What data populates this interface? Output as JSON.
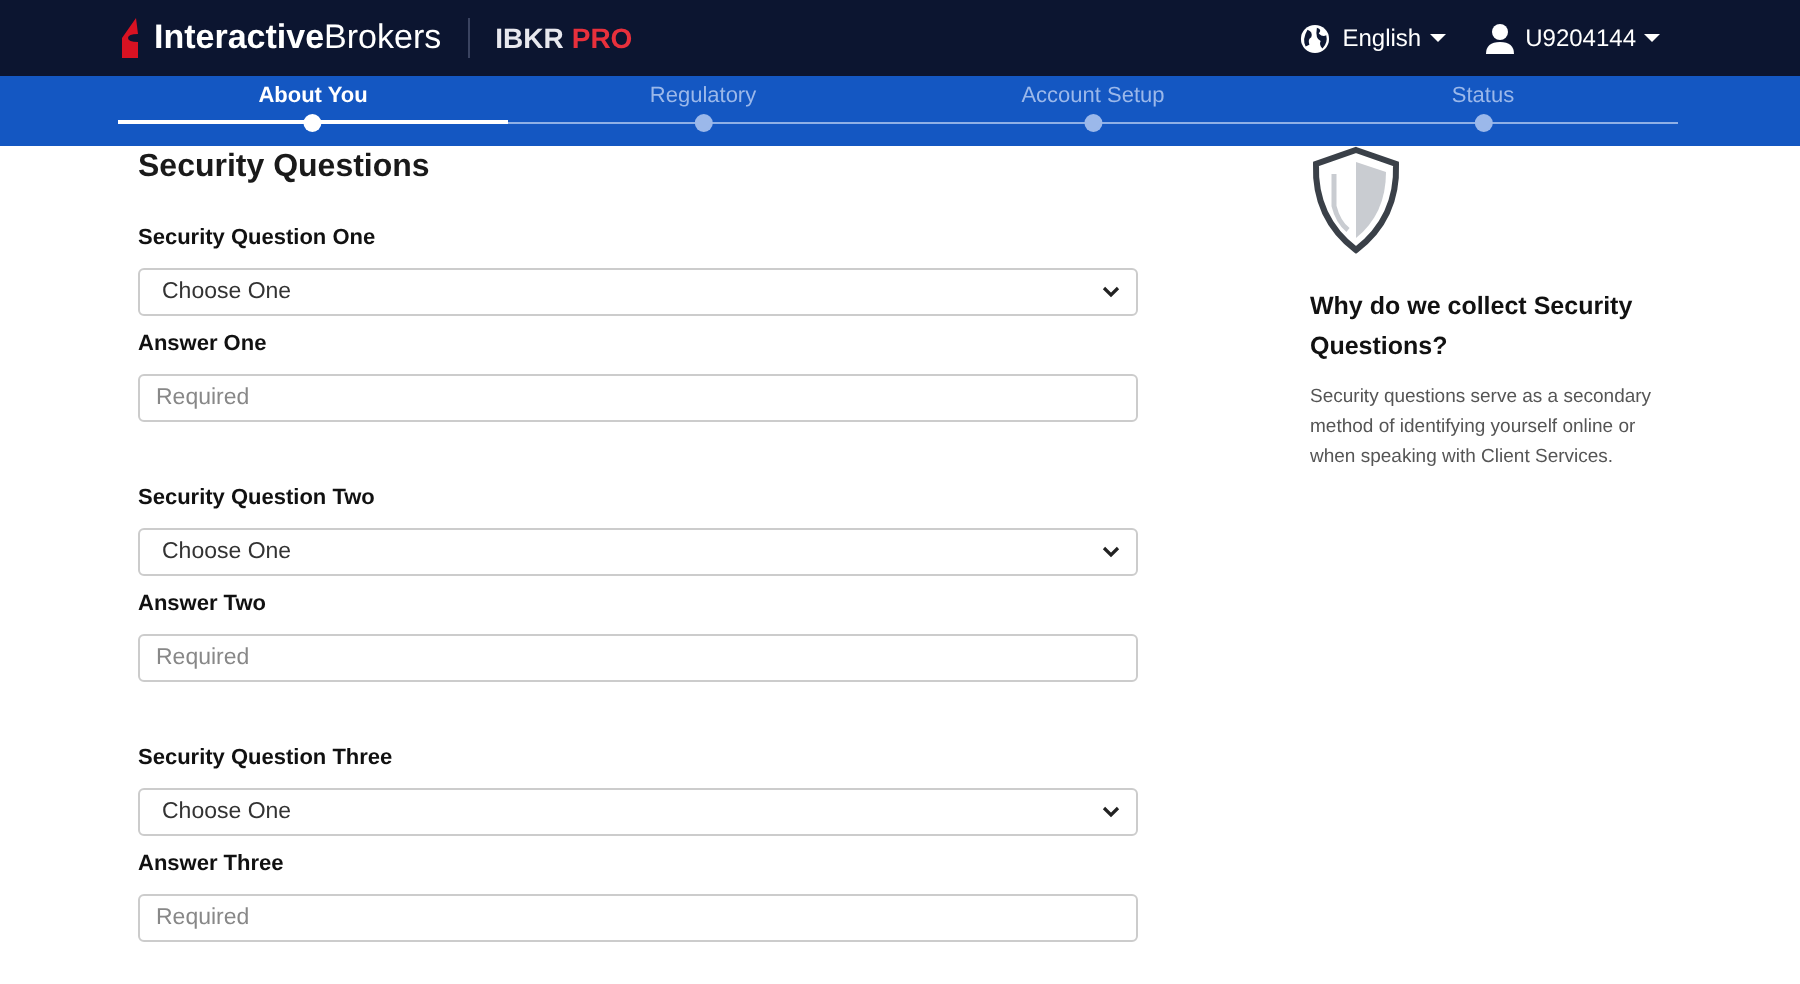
{
  "header": {
    "logo": "**Interactive**Brokers",
    "product": "IBKR",
    "product_tier": "PRO",
    "language": "English",
    "user": "U9204144"
  },
  "steps": [
    {
      "label": "About You",
      "selected": true
    },
    {
      "label": "Regulatory",
      "selected": false
    },
    {
      "label": "Account Setup",
      "selected": false
    },
    {
      "label": "Status",
      "selected": false
    }
  ],
  "form": {
    "title": "Security Questions",
    "groups": [
      {
        "question_label": "Security Question One",
        "select": "Choose One",
        "answer_label": "Answer One",
        "placeholder": "Required"
      },
      {
        "question_label": "Security Question Two",
        "select": "Choose One",
        "answer_label": "Answer Two",
        "placeholder": "Required"
      },
      {
        "question_label": "Security Question Three",
        "select": "Choose One",
        "answer_label": "Answer Three",
        "placeholder": "Required"
      }
    ]
  },
  "aside": {
    "title": "Why do we collect Security Questions?",
    "body": "Security questions serve as a secondary method of identifying yourself online or when speaking with Client Services."
  }
}
